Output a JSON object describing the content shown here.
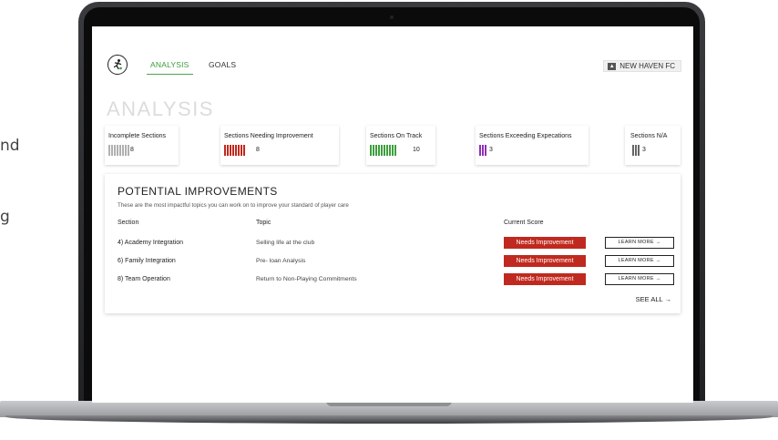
{
  "left_text": [
    "nd",
    "g"
  ],
  "nav": {
    "tabs": [
      {
        "label": "ANALYSIS",
        "active": true
      },
      {
        "label": "GOALS",
        "active": false
      }
    ],
    "club_name": "NEW HAVEN FC",
    "logo_icon": "soccer-player-icon"
  },
  "page_title": "ANALYSIS",
  "summary_cards": [
    {
      "label": "Incomplete Sections",
      "value": "8",
      "color": "#b0b0b0",
      "bars": 8
    },
    {
      "label": "Sections Needing Improvement",
      "value": "8",
      "color": "#c0291f",
      "bars": 8
    },
    {
      "label": "Sections On Track",
      "value": "10",
      "color": "#3e9e3e",
      "bars": 10
    },
    {
      "label": "Sections Exceeding Expecations",
      "value": "3",
      "color": "#8e2fb8",
      "bars": 3
    },
    {
      "label": "Sections N/A",
      "value": "3",
      "color": "#666666",
      "bars": 3
    }
  ],
  "improvements": {
    "title": "POTENTIAL IMPROVEMENTS",
    "subtitle": "These are the most impactful topics you can work on to improve your standard of player care",
    "columns": {
      "section": "Section",
      "topic": "Topic",
      "score": "Current Score"
    },
    "rows": [
      {
        "section": "4) Academy Integration",
        "topic": "Selling life at the club",
        "score": "Needs Improvement",
        "action": "LEARN MORE →"
      },
      {
        "section": "6) Family Integration",
        "topic": "Pre- loan Analysis",
        "score": "Needs Improvement",
        "action": "LEARN MORE →"
      },
      {
        "section": "8) Team Operation",
        "topic": "Return to Non-Playing Commitments",
        "score": "Needs Improvement",
        "action": "LEARN MORE →"
      }
    ],
    "see_all": "SEE ALL →"
  }
}
